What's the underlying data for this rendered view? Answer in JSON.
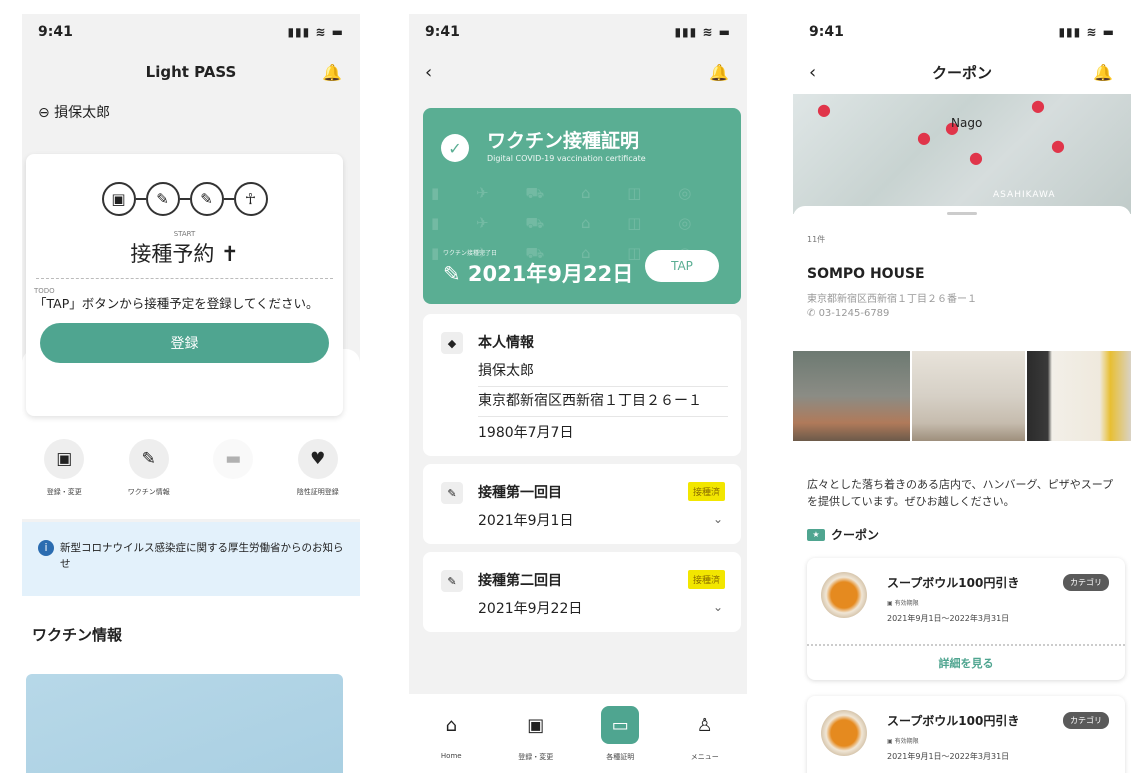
{
  "status": {
    "time": "9:41",
    "signal": "▮▮▮ ≋ ▬"
  },
  "screen1": {
    "title": "Light PASS",
    "user": "⊖ 損保太郎",
    "start_label": "START",
    "appointment": "接種予約 ✝",
    "todo_label": "TODO",
    "todo_text": "「TAP」ボタンから接種予定を登録してください。",
    "register_button": "登録",
    "quick_actions": [
      {
        "label": "登録・変更"
      },
      {
        "label": "ワクチン情報"
      },
      {
        "label": ""
      },
      {
        "label": "陰性証明登録"
      }
    ],
    "notice": "新型コロナウイルス感染症に関する厚生労働省からのお知らせ",
    "section_title": "ワクチン情報"
  },
  "screen2": {
    "cert_title": "ワクチン接種証明",
    "cert_sub": "Digital COVID-19 vaccination certificate",
    "plan_label": "ワクチン接種完了日",
    "date": "✎ 2021年9月22日",
    "tap_button": "TAP",
    "personal": {
      "title": "本人情報",
      "name": "損保太郎",
      "address": "東京都新宿区西新宿１丁目２６ー１",
      "birth": "1980年7月7日"
    },
    "dose1": {
      "title": "接種第一回目",
      "badge": "接種済",
      "date": "2021年9月1日"
    },
    "dose2": {
      "title": "接種第二回目",
      "badge": "接種済",
      "date": "2021年9月22日"
    },
    "tabs": [
      {
        "label": "Home"
      },
      {
        "label": "登録・変更"
      },
      {
        "label": "各種証明"
      },
      {
        "label": "メニュー"
      }
    ]
  },
  "screen3": {
    "title": "クーポン",
    "map_label_city": "Nago",
    "map_label_area": "ASAHIKAWA",
    "count": "11件",
    "shop_name": "SOMPO HOUSE",
    "address": "東京都新宿区西新宿１丁目２６番ー１",
    "phone": "03-1245-6789",
    "description": "広々とした落ち着きのある店内で、ハンバーグ、ピザやスープを提供しています。ぜひお越しください。",
    "coupon_header": "クーポン",
    "coupons": [
      {
        "title": "スープボウル100円引き",
        "category": "カテゴリ",
        "valid_label": "有効期限",
        "period": "2021年9月1日〜2022年3月31日",
        "more": "詳細を見る"
      },
      {
        "title": "スープボウル100円引き",
        "category": "カテゴリ",
        "valid_label": "有効期限",
        "period": "2021年9月1日〜2022年3月31日"
      }
    ]
  }
}
